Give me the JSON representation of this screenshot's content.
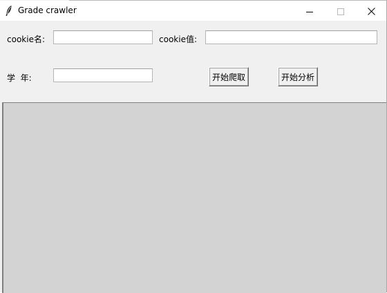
{
  "window": {
    "title": "Grade crawler",
    "icon": "feather-icon"
  },
  "form": {
    "cookie_name_label": "cookie名:",
    "cookie_name_value": "",
    "cookie_value_label": "cookie值:",
    "cookie_value_value": "",
    "year_label": "学  年:",
    "year_value": "",
    "start_crawl_button": "开始爬取",
    "start_analysis_button": "开始分析"
  },
  "canvas": {
    "background": "#d3d3d3"
  }
}
